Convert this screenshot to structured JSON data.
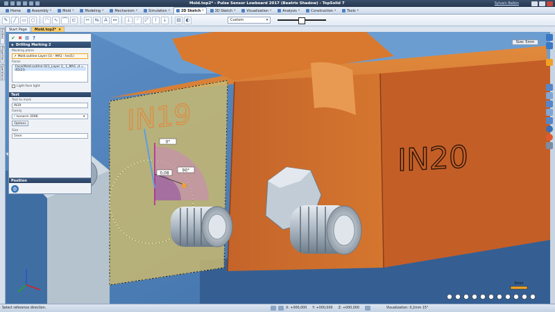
{
  "window": {
    "title": "Mold.top2* - Pulse Sensor Lowboard 2017 (Beatrix Shadow) - TopSolid 7",
    "user": "Sylvain Balbin"
  },
  "ribbon": {
    "tabs": [
      {
        "label": "Home",
        "active": false
      },
      {
        "label": "Assembly",
        "active": false
      },
      {
        "label": "Mold",
        "active": false
      },
      {
        "label": "Modeling",
        "active": false
      },
      {
        "label": "Mechanism",
        "active": false
      },
      {
        "label": "Simulation",
        "active": false
      },
      {
        "label": "2D Sketch",
        "active": true
      },
      {
        "label": "3D Sketch",
        "active": false
      },
      {
        "label": "Visualization",
        "active": false
      },
      {
        "label": "Analysis",
        "active": false
      },
      {
        "label": "Construction",
        "active": false
      },
      {
        "label": "Tools",
        "active": false
      }
    ]
  },
  "toolbar": {
    "line_style": "Custom"
  },
  "doc_tabs": [
    {
      "label": "Start Page",
      "active": false
    },
    {
      "label": "Mold.top2*",
      "active": true
    }
  ],
  "left_strip": [
    "Entities",
    "Properties",
    "Operations"
  ],
  "panel": {
    "title": "Drilling Marking 2",
    "marking_plane_label": "Marking plane",
    "marking_plane_value": "Mold.outline Layer (1) - MA1 - Ins(1)",
    "faces_label": "Faces",
    "faces_value": "Face(Mold.outline 021_Layer 2_ 1_MA1 ,d = 45(2))",
    "light_face_label": "Light face light",
    "text_section": "Text",
    "text_to_mark_label": "Text to mark",
    "text_to_mark_value": "IN19",
    "family_label": "Family",
    "family_value": "Isonorm 3098",
    "options_button": "Options",
    "size_label": "Size",
    "size_value": "5mm",
    "position_section": "Position"
  },
  "viewport": {
    "scale_label": "Size: 5mm",
    "engraving_text_1": "IN19",
    "engraving_text_2": "IN20",
    "angle_label_1": "0°",
    "angle_label_2": "90°",
    "offset_label": "0,08",
    "scale_bar_label": "5mm"
  },
  "status": {
    "message": "Select reference direction.",
    "x": "X: +000,000",
    "y": "Y: +000,000",
    "z": "Z: +000,000",
    "visualization": "Visualization: 0,2mm 15°"
  },
  "colors": {
    "accent": "#f2a126",
    "copper": "#d8772b",
    "steel_blue": "#4b7db5"
  }
}
